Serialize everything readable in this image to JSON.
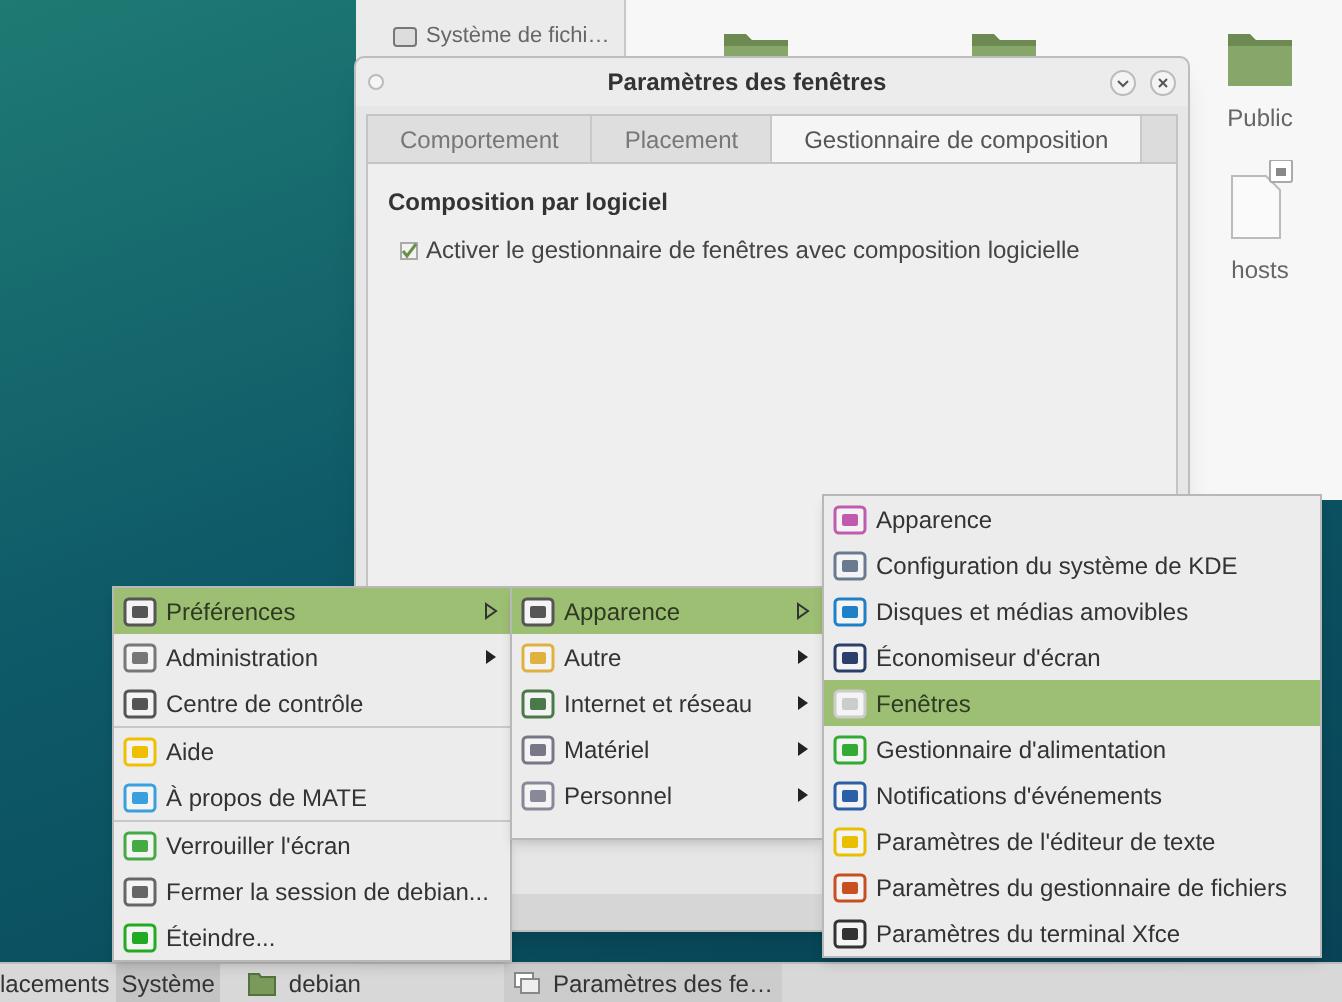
{
  "file_manager": {
    "sidebar_items": [
      {
        "label": "Système de fichi…"
      }
    ],
    "files": [
      {
        "name": "Public",
        "kind": "folder"
      },
      {
        "name": "hosts",
        "kind": "file"
      }
    ]
  },
  "dialog": {
    "title": "Paramètres des fenêtres",
    "tabs": [
      {
        "label": "Comportement",
        "selected": false
      },
      {
        "label": "Placement",
        "selected": false
      },
      {
        "label": "Gestionnaire de composition",
        "selected": true
      }
    ],
    "section_title": "Composition par logiciel",
    "checkbox": {
      "label": "Activer le gestionnaire de fenêtres avec composition logicielle",
      "checked": true
    }
  },
  "menus": [
    {
      "groups": [
        [
          {
            "label": "Préférences",
            "selected": true,
            "submenu": true
          },
          {
            "label": "Administration",
            "selected": false,
            "submenu": true
          },
          {
            "label": "Centre de contrôle",
            "selected": false,
            "submenu": false
          }
        ],
        [
          {
            "label": "Aide",
            "selected": false,
            "submenu": false
          },
          {
            "label": "À propos de MATE",
            "selected": false,
            "submenu": false
          }
        ],
        [
          {
            "label": "Verrouiller l'écran",
            "selected": false,
            "submenu": false
          },
          {
            "label": "Fermer la session de debian...",
            "selected": false,
            "submenu": false
          },
          {
            "label": "Éteindre...",
            "selected": false,
            "submenu": false
          }
        ]
      ]
    },
    {
      "groups": [
        [
          {
            "label": "Apparence",
            "selected": true,
            "submenu": true
          },
          {
            "label": "Autre",
            "selected": false,
            "submenu": true
          },
          {
            "label": "Internet et réseau",
            "selected": false,
            "submenu": true
          },
          {
            "label": "Matériel",
            "selected": false,
            "submenu": true
          },
          {
            "label": "Personnel",
            "selected": false,
            "submenu": true
          }
        ]
      ]
    },
    {
      "groups": [
        [
          {
            "label": "Apparence",
            "selected": false,
            "submenu": false
          },
          {
            "label": "Configuration du système de KDE",
            "selected": false,
            "submenu": false
          },
          {
            "label": "Disques et médias amovibles",
            "selected": false,
            "submenu": false
          },
          {
            "label": "Économiseur d'écran",
            "selected": false,
            "submenu": false
          },
          {
            "label": "Fenêtres",
            "selected": true,
            "submenu": false
          },
          {
            "label": "Gestionnaire d'alimentation",
            "selected": false,
            "submenu": false
          },
          {
            "label": "Notifications d'événements",
            "selected": false,
            "submenu": false
          },
          {
            "label": "Paramètres de l'éditeur de texte",
            "selected": false,
            "submenu": false
          },
          {
            "label": "Paramètres du gestionnaire de fichiers",
            "selected": false,
            "submenu": false
          },
          {
            "label": "Paramètres du terminal Xfce",
            "selected": false,
            "submenu": false
          }
        ]
      ]
    }
  ],
  "taskbar": {
    "items": [
      {
        "label": "lacements",
        "kind": "menu",
        "selected": false
      },
      {
        "label": "Système",
        "kind": "menu",
        "selected": true
      },
      {
        "label": "debian",
        "kind": "launcher",
        "selected": false
      },
      {
        "label": "Paramètres des fe…",
        "kind": "window",
        "selected": false
      }
    ]
  }
}
